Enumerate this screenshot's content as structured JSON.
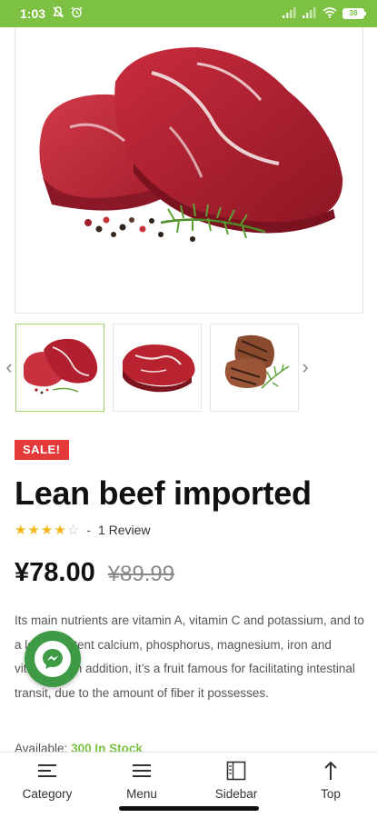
{
  "status_bar": {
    "time": "1:03",
    "battery": "38",
    "color": "#7cc142"
  },
  "gallery": {
    "main_image": "raw-beef-steaks-with-peppercorns-and-rosemary",
    "thumbnails": [
      "beef-steaks-thumb",
      "beef-steak-thumb",
      "grilled-steaks-thumb"
    ],
    "prev_icon": "chevron-left-icon",
    "next_icon": "chevron-right-icon"
  },
  "product": {
    "badge": "SALE!",
    "title": "Lean beef imported",
    "rating": 4,
    "rating_max": 5,
    "separator": "-",
    "reviews": "1 Review",
    "price_current": "¥78.00",
    "price_old": "¥89.99",
    "description": "Its main nutrients are vitamin A, vitamin C and potassium, and to a lesser extent calcium, phosphorus, magnesium, iron and vitamin E. In addition, it’s a fruit famous for facilitating intestinal transit, due to the amount of fiber it possesses.",
    "availability_label": "Available:",
    "availability_value": "300 In Stock"
  },
  "messenger": {
    "icon": "messenger-icon",
    "color": "#3e9a44"
  },
  "bottom_nav": {
    "items": [
      {
        "label": "Category",
        "icon": "category-icon"
      },
      {
        "label": "Menu",
        "icon": "menu-icon"
      },
      {
        "label": "Sidebar",
        "icon": "sidebar-icon"
      },
      {
        "label": "Top",
        "icon": "arrow-up-icon"
      }
    ]
  },
  "colors": {
    "accent": "#7cc142",
    "sale": "#e53a3a",
    "star": "#f4b619"
  }
}
